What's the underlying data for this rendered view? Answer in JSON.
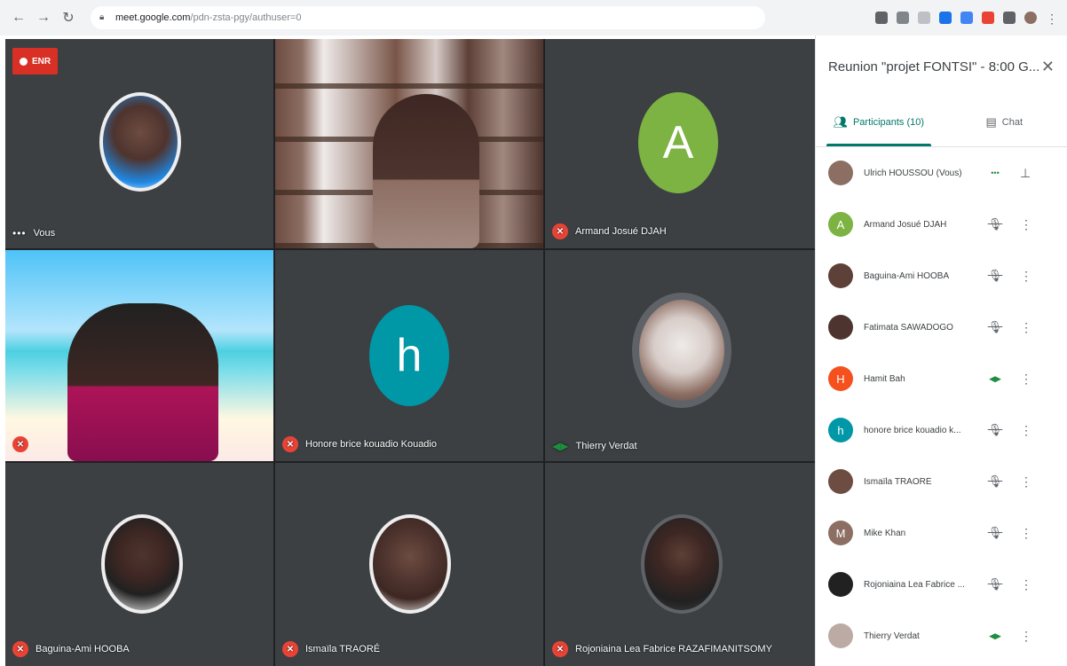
{
  "browser": {
    "url_host": "meet.google.com",
    "url_path": "/pdn-zsta-pgy/authuser=0"
  },
  "meeting": {
    "rec_label": "ENR",
    "tiles": [
      {
        "name": "Vous",
        "status": "dots"
      },
      {
        "name": "Armand Josué DJAH",
        "status": "muted"
      },
      {
        "name": "Honore brice kouadio Kouadio",
        "status": "muted"
      },
      {
        "name": "Thierry Verdat",
        "status": "talking"
      },
      {
        "name": "Baguina-Ami HOOBA",
        "status": "muted"
      },
      {
        "name": "Ismaïla TRAORÉ",
        "status": "muted"
      },
      {
        "name": "Rojoniaina Lea Fabrice RAZAFIMANITSOMY",
        "status": "muted"
      }
    ],
    "letter_tiles": {
      "a": "A",
      "h": "h"
    }
  },
  "panel": {
    "title": "Reunion \"projet FONTSI\" - 8:00 G...",
    "tab_participants": "Participants (10)",
    "tab_chat": "Chat",
    "participants": [
      {
        "name": "Ulrich HOUSSOU (Vous)",
        "avatar": "photo",
        "color": "#8d6e63",
        "mic": "dots",
        "more": "pin"
      },
      {
        "name": "Armand Josué DJAH",
        "avatar": "A",
        "color": "#7cb342",
        "mic": "muted",
        "more": "more"
      },
      {
        "name": "Baguina-Ami HOOBA",
        "avatar": "photo",
        "color": "#5d4037",
        "mic": "muted",
        "more": "more"
      },
      {
        "name": "Fatimata SAWADOGO",
        "avatar": "photo",
        "color": "#4e342e",
        "mic": "muted",
        "more": "more"
      },
      {
        "name": "Hamit Bah",
        "avatar": "H",
        "color": "#f4511e",
        "mic": "on",
        "more": "more"
      },
      {
        "name": "honore brice kouadio k...",
        "avatar": "h",
        "color": "#0097a7",
        "mic": "muted",
        "more": "more"
      },
      {
        "name": "Ismaïla TRAORÉ",
        "avatar": "photo",
        "color": "#6d4c41",
        "mic": "muted",
        "more": "more"
      },
      {
        "name": "Mike Khan",
        "avatar": "M",
        "color": "#8d6e63",
        "mic": "muted",
        "more": "more"
      },
      {
        "name": "Rojoniaina Lea Fabrice ...",
        "avatar": "photo",
        "color": "#212121",
        "mic": "muted",
        "more": "more"
      },
      {
        "name": "Thierry Verdat",
        "avatar": "photo",
        "color": "#bcaaa4",
        "mic": "on",
        "more": "more"
      }
    ]
  }
}
